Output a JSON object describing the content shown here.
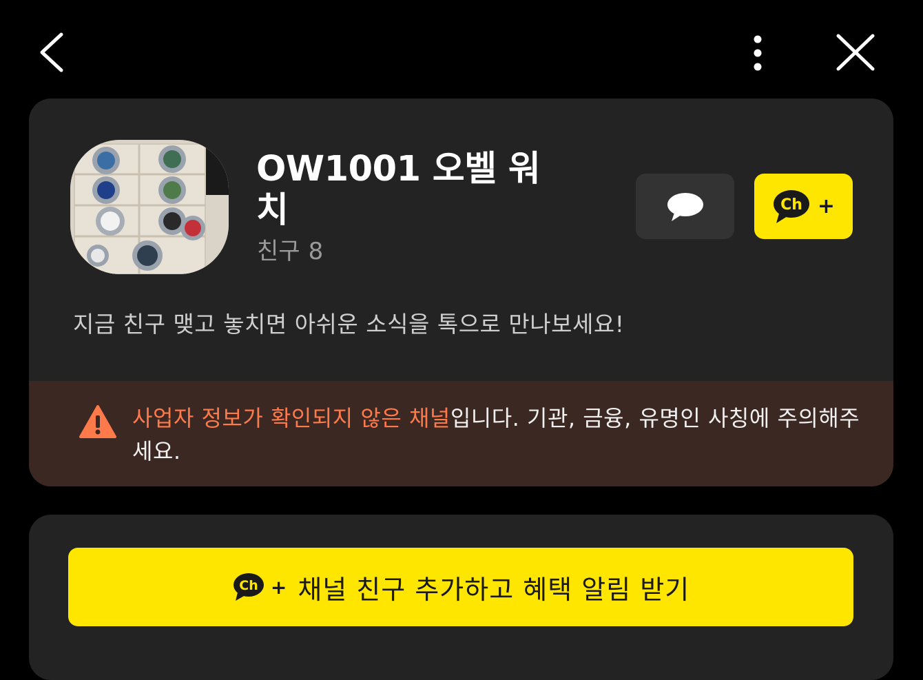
{
  "topbar": {
    "back_icon": "chevron-left-icon",
    "more_icon": "more-vertical-icon",
    "close_icon": "close-icon"
  },
  "profile": {
    "name": "OW1001 오벨 워치",
    "friend_label": "친구",
    "friend_count": "8",
    "description": "지금 친구 맺고 놓치면 아쉬운 소식을 톡으로 만나보세요!",
    "chat_icon": "chat-bubble-icon",
    "add_icon": "channel-plus-icon",
    "ch_text": "Ch",
    "plus_text": "+"
  },
  "warning": {
    "icon": "warning-triangle-icon",
    "highlight": "사업자 정보가 확인되지 않은 채널",
    "rest": "입니다. 기관, 금융, 유명인 사칭에 주의해주세요."
  },
  "cta": {
    "ch_text": "Ch",
    "plus_text": "+",
    "label": "채널 친구 추가하고 혜택 알림 받기"
  },
  "colors": {
    "background": "#000000",
    "card": "#232323",
    "accent_yellow": "#ffe600",
    "warning_bg": "#3b2823",
    "warning_highlight": "#ff7a4a"
  }
}
